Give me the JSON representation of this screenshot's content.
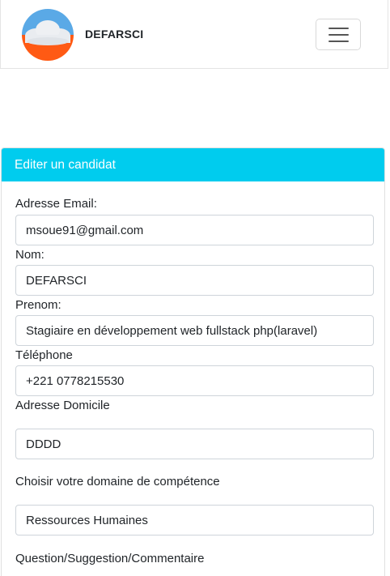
{
  "navbar": {
    "brand": "DEFARSCI",
    "logo_icon": "cloud-logo-icon",
    "toggler_icon": "hamburger-menu-icon"
  },
  "colors": {
    "header_bg": "#00ccee",
    "logo_top": "#5aa9e6",
    "logo_bottom": "#ff5a14"
  },
  "card": {
    "title": "Editer un candidat"
  },
  "form": {
    "email_label": "Adresse Email:",
    "email_value": "msoue91@gmail.com",
    "nom_label": "Nom:",
    "nom_value": "DEFARSCI",
    "prenom_label": "Prenom:",
    "prenom_value": "Stagiaire en développement web fullstack php(laravel)",
    "tel_label": "Téléphone",
    "tel_value": "+221 0778215530",
    "adresse_label": "Adresse Domicile",
    "adresse_value": "DDDD",
    "domaine_label": "Choisir votre domaine de compétence",
    "domaine_value": "Ressources Humaines",
    "question_label": "Question/Suggestion/Commentaire"
  }
}
